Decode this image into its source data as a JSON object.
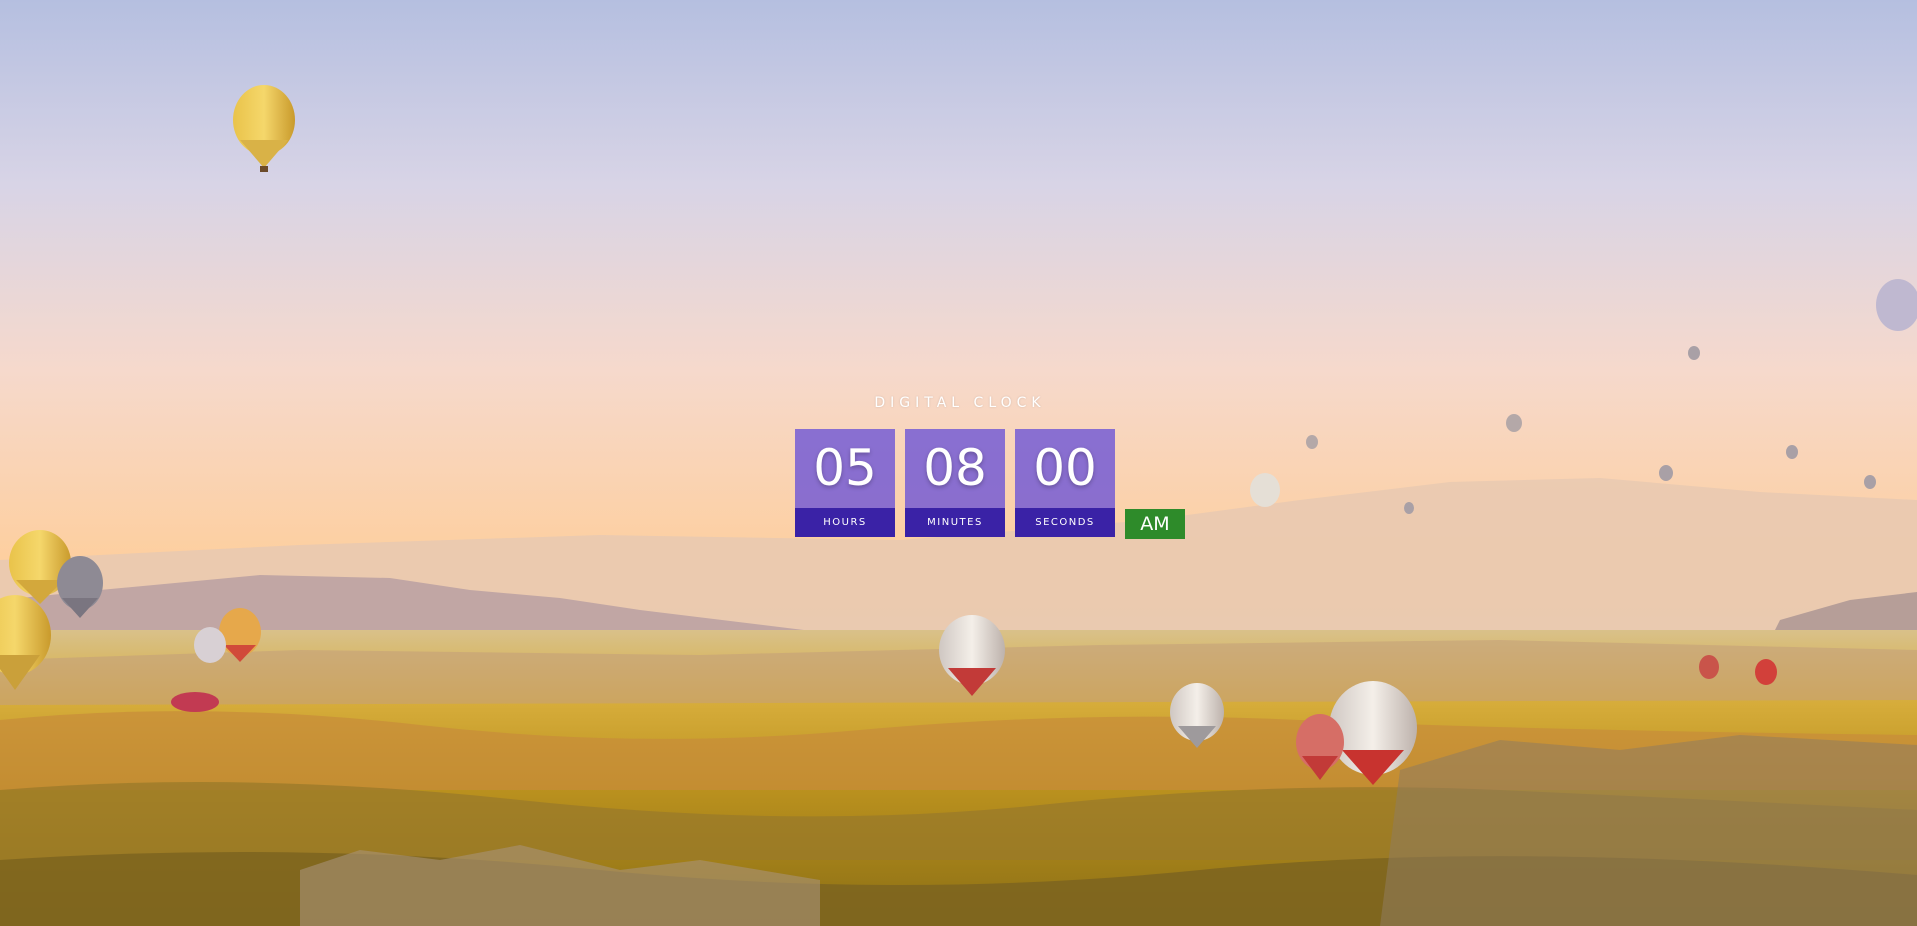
{
  "clock": {
    "title": "DIGITAL CLOCK",
    "hours": "05",
    "minutes": "08",
    "seconds": "00",
    "hours_label": "HOURS",
    "minutes_label": "MINUTES",
    "seconds_label": "SECONDS",
    "period": "AM"
  },
  "colors": {
    "digit_box": "#7058d6",
    "label_box": "#3a22a6",
    "period_box": "#2e8b2a",
    "sky_top": "#b7c0e0",
    "sky_horizon": "#fbd2a5",
    "ground": "#c9a22e"
  }
}
